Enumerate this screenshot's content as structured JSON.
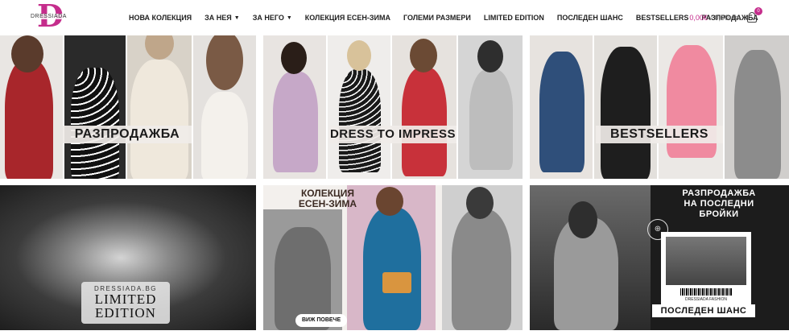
{
  "header": {
    "logo_text": "DRESSIADA",
    "logo_letter": "D",
    "nav": [
      {
        "label": "НОВА КОЛЕКЦИЯ",
        "dropdown": false
      },
      {
        "label": "ЗА НЕЯ",
        "dropdown": true
      },
      {
        "label": "ЗА НЕГО",
        "dropdown": true
      },
      {
        "label": "КОЛЕКЦИЯ ЕСЕН-ЗИМА",
        "dropdown": false
      },
      {
        "label": "ГОЛЕМИ РАЗМЕРИ",
        "dropdown": false
      },
      {
        "label": "LIMITED EDITION",
        "dropdown": false
      },
      {
        "label": "ПОСЛЕДЕН ШАНС",
        "dropdown": false
      },
      {
        "label": "BESTSELLERS",
        "dropdown": false
      },
      {
        "label": "РАЗПРОДАЖБА",
        "dropdown": false
      }
    ],
    "cart": {
      "price": "0,00€",
      "separator": "/",
      "price_lv": "0,00 лв.",
      "count": "0",
      "icon": "basket-icon"
    }
  },
  "banners": {
    "sale": {
      "label": "РАЗПРОДАЖБА"
    },
    "dress_to_impress": {
      "label": "DRESS TO IMPRESS"
    },
    "bestsellers": {
      "label": "BESTSELLERS"
    },
    "limited": {
      "site": "DRESSIADA.BG",
      "title_line1": "LIMITED",
      "title_line2": "EDITION"
    },
    "autumn": {
      "title_line1": "КОЛЕКЦИЯ",
      "title_line2": "ЕСЕН-ЗИМА",
      "button": "ВИЖ ПОВЕЧЕ"
    },
    "last_chance": {
      "line1": "РАЗПРОДАЖБА",
      "line2": "НА ПОСЛЕДНИ",
      "line3": "БРОЙКИ",
      "caption": "DRESSIADA FASHION",
      "bottom": "ПОСЛЕДЕН ШАНС"
    }
  },
  "colors": {
    "brand": "#c52d8c",
    "text": "#222222"
  }
}
